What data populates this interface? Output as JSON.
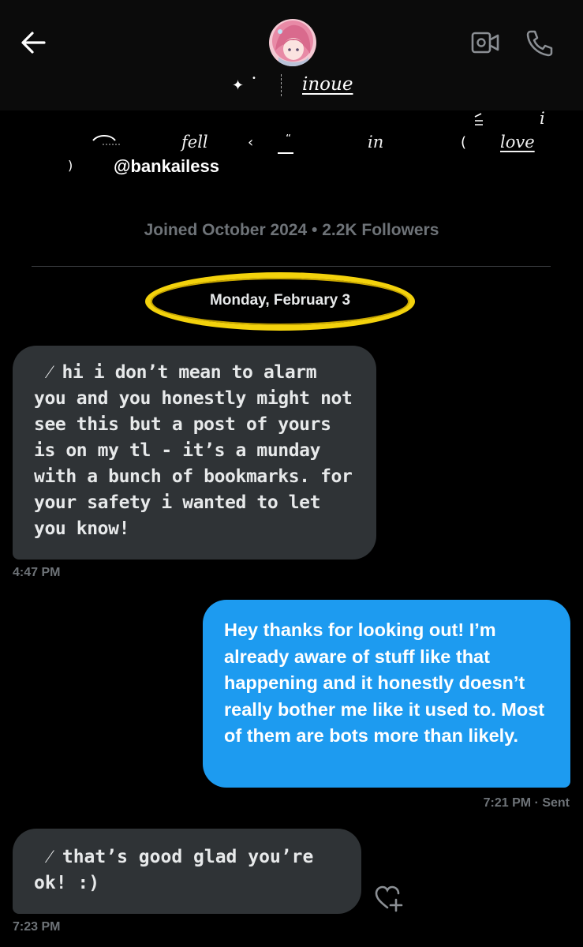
{
  "header": {
    "name": "inoue",
    "sparkle": "✦",
    "sparkle_dot": "•"
  },
  "profile": {
    "bio_words": [
      "fell",
      "in",
      "love"
    ],
    "bio_i": "i",
    "handle": "@bankailess",
    "joined": "Joined October 2024 • 2.2K Followers"
  },
  "conversation": {
    "date_label": "Monday, February 3",
    "messages": [
      {
        "direction": "received",
        "prefix": "⁄",
        "text": "hi i don’t mean to alarm you and you honestly might not see this but a post of yours is on my tl - it’s a munday with a bunch of bookmarks. for your safety i wanted to let you know!",
        "time": "4:47 PM"
      },
      {
        "direction": "sent",
        "text": "Hey thanks for looking out! I’m already aware of stuff like that happening and it honestly doesn’t really bother me like it used to. Most of them are bots more than likely.",
        "time": "7:21 PM · Sent"
      },
      {
        "direction": "received",
        "prefix": "⁄",
        "text": "that’s good glad you’re ok! :)",
        "time": "7:23 PM"
      }
    ]
  },
  "colors": {
    "background": "#000000",
    "received_bubble": "#2f3336",
    "sent_bubble": "#1d9bf0",
    "muted_text": "#6e7378",
    "highlight_ring": "#f3d20c"
  },
  "icons": {
    "back": "arrow-left-icon",
    "video": "video-call-icon",
    "phone": "phone-icon",
    "react": "heart-plus-icon"
  }
}
